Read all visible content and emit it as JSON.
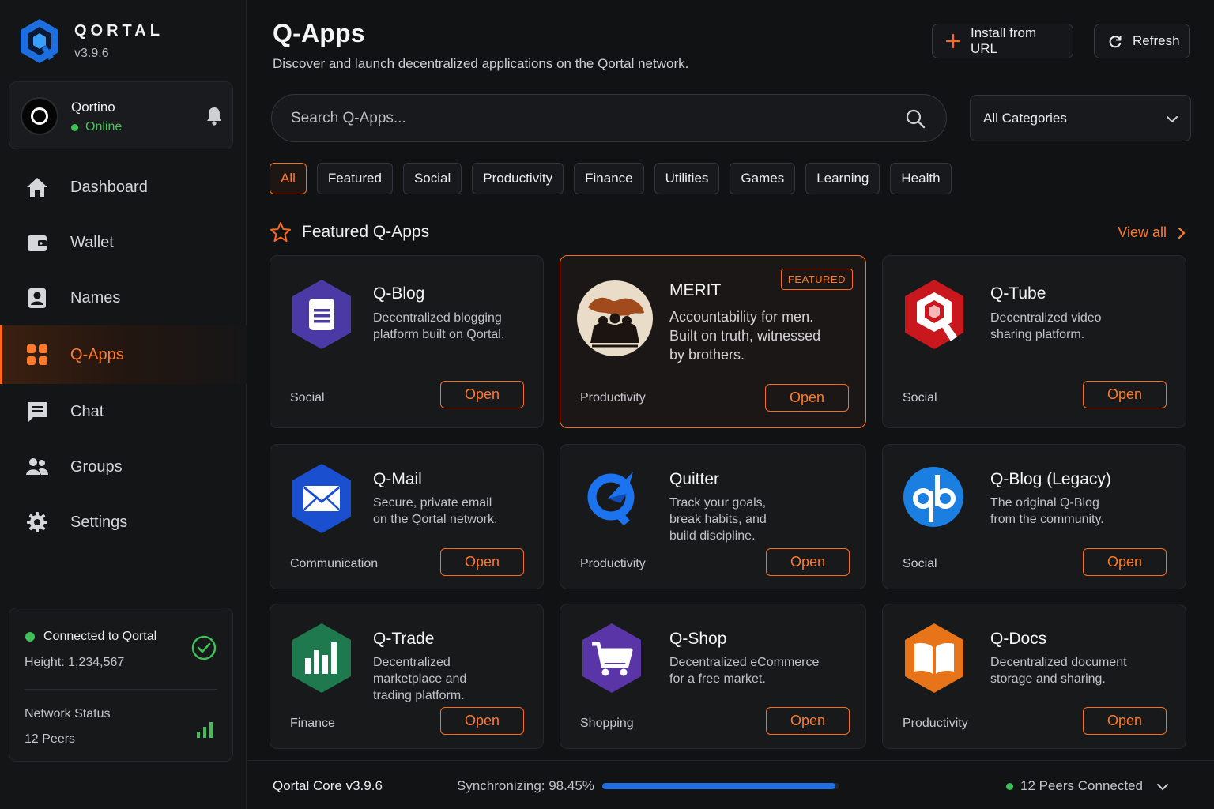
{
  "brand": {
    "name": "QORTAL",
    "version": "v3.9.6"
  },
  "user": {
    "name": "Qortino",
    "status": "Online"
  },
  "nav": [
    {
      "label": "Dashboard",
      "icon": "home-icon"
    },
    {
      "label": "Wallet",
      "icon": "wallet-icon"
    },
    {
      "label": "Names",
      "icon": "names-icon"
    },
    {
      "label": "Q-Apps",
      "icon": "apps-grid-icon",
      "active": true
    },
    {
      "label": "Chat",
      "icon": "chat-icon"
    },
    {
      "label": "Groups",
      "icon": "groups-icon"
    },
    {
      "label": "Settings",
      "icon": "gear-icon"
    }
  ],
  "connection": {
    "title": "Connected to Qortal",
    "height": "Height: 1,234,567",
    "network_label": "Network Status",
    "peers": "12 Peers"
  },
  "header": {
    "title": "Q-Apps",
    "subtitle": "Discover and launch decentralized applications on the Qortal network.",
    "install_label": "Install from URL",
    "refresh_label": "Refresh"
  },
  "search": {
    "placeholder": "Search Q-Apps..."
  },
  "category_select": {
    "value": "All Categories"
  },
  "chips": [
    "All",
    "Featured",
    "Social",
    "Productivity",
    "Finance",
    "Utilities",
    "Games",
    "Learning",
    "Health"
  ],
  "featured": {
    "title": "Featured Q-Apps",
    "view_all": "View all"
  },
  "apps": [
    {
      "name": "Q-Blog",
      "desc": [
        "Decentralized blogging",
        "platform built on Qortal."
      ],
      "category": "Social",
      "open": "Open",
      "icon": "q-blog-icon"
    },
    {
      "name": "MERIT",
      "desc": [
        "Accountability for men.",
        "Built on truth, witnessed",
        "by brothers."
      ],
      "category": "Productivity",
      "open": "Open",
      "badge": "FEATURED",
      "icon": "merit-logo"
    },
    {
      "name": "Q-Tube",
      "desc": [
        "Decentralized video",
        "sharing platform."
      ],
      "category": "Social",
      "open": "Open",
      "icon": "q-tube-icon"
    },
    {
      "name": "Q-Mail",
      "desc": [
        "Secure, private email",
        "on the Qortal network."
      ],
      "category": "Communication",
      "open": "Open",
      "icon": "q-mail-icon"
    },
    {
      "name": "Quitter",
      "desc": [
        "Track your goals,",
        "break habits, and",
        "build discipline."
      ],
      "category": "Productivity",
      "open": "Open",
      "icon": "quitter-icon"
    },
    {
      "name": "Q-Blog (Legacy)",
      "desc": [
        "The original Q-Blog",
        "from the community."
      ],
      "category": "Social",
      "open": "Open",
      "icon": "q-blog-legacy-icon"
    },
    {
      "name": "Q-Trade",
      "desc": [
        "Decentralized",
        "marketplace and",
        "trading platform."
      ],
      "category": "Finance",
      "open": "Open",
      "icon": "q-trade-icon"
    },
    {
      "name": "Q-Shop",
      "desc": [
        "Decentralized eCommerce",
        "for a free market."
      ],
      "category": "Shopping",
      "open": "Open",
      "icon": "q-shop-icon"
    },
    {
      "name": "Q-Docs",
      "desc": [
        "Decentralized document",
        "storage and sharing."
      ],
      "category": "Productivity",
      "open": "Open",
      "icon": "q-docs-icon"
    }
  ],
  "status_bar": {
    "core_version": "Qortal Core v3.9.6",
    "sync_label": "Synchronizing: 98.45%",
    "sync_progress": 0.9845,
    "peers_connected": "12 Peers Connected"
  },
  "colors": {
    "accent": "#ff6a1a",
    "online": "#3fbf57",
    "sync": "#1f6fe0"
  }
}
